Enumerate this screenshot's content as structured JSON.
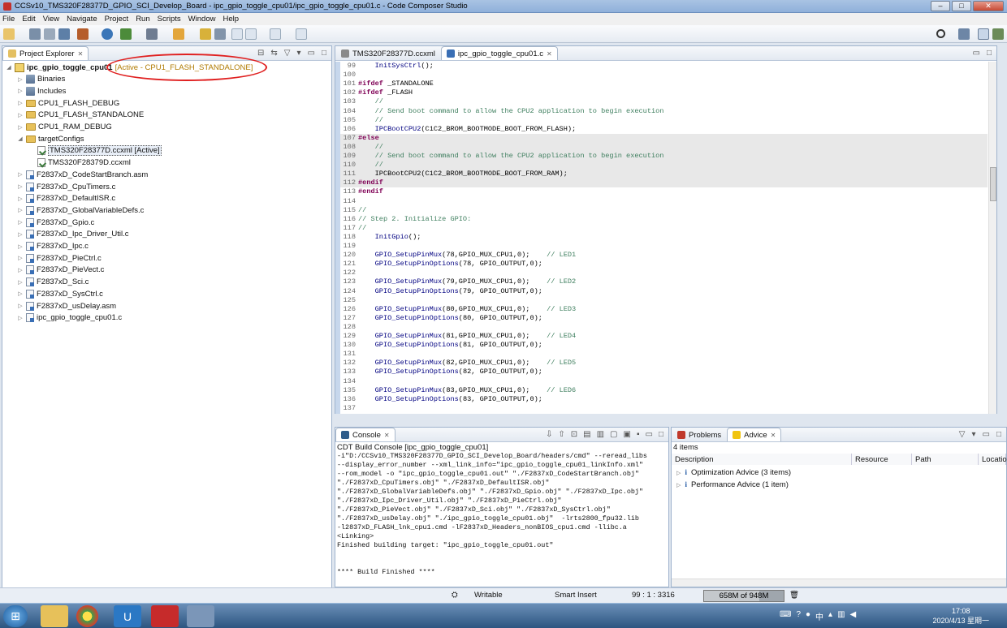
{
  "window": {
    "title": "CCSv10_TMS320F28377D_GPIO_SCI_Develop_Board - ipc_gpio_toggle_cpu01/ipc_gpio_toggle_cpu01.c - Code Composer Studio"
  },
  "menu": [
    "File",
    "Edit",
    "View",
    "Navigate",
    "Project",
    "Run",
    "Scripts",
    "Window",
    "Help"
  ],
  "explorer": {
    "tab_label": "Project Explorer",
    "project_name": "ipc_gpio_toggle_cpu01",
    "project_status": "[Active - CPU1_FLASH_STANDALONE]",
    "items": [
      {
        "label": "Binaries",
        "kind": "lib",
        "indent": 1,
        "arrow": "▷"
      },
      {
        "label": "Includes",
        "kind": "lib",
        "indent": 1,
        "arrow": "▷"
      },
      {
        "label": "CPU1_FLASH_DEBUG",
        "kind": "folder",
        "indent": 1,
        "arrow": "▷"
      },
      {
        "label": "CPU1_FLASH_STANDALONE",
        "kind": "folder",
        "indent": 1,
        "arrow": "▷"
      },
      {
        "label": "CPU1_RAM_DEBUG",
        "kind": "folder",
        "indent": 1,
        "arrow": "▷"
      },
      {
        "label": "targetConfigs",
        "kind": "folder",
        "indent": 1,
        "arrow": "◢"
      },
      {
        "label": "TMS320F28377D.ccxml [Active]",
        "kind": "xml",
        "indent": 2,
        "arrow": "",
        "boxed": true
      },
      {
        "label": "TMS320F28379D.ccxml",
        "kind": "xml",
        "indent": 2,
        "arrow": ""
      },
      {
        "label": "F2837xD_CodeStartBranch.asm",
        "kind": "c",
        "indent": 1,
        "arrow": "▷"
      },
      {
        "label": "F2837xD_CpuTimers.c",
        "kind": "c",
        "indent": 1,
        "arrow": "▷"
      },
      {
        "label": "F2837xD_DefaultISR.c",
        "kind": "c",
        "indent": 1,
        "arrow": "▷"
      },
      {
        "label": "F2837xD_GlobalVariableDefs.c",
        "kind": "c",
        "indent": 1,
        "arrow": "▷"
      },
      {
        "label": "F2837xD_Gpio.c",
        "kind": "c",
        "indent": 1,
        "arrow": "▷"
      },
      {
        "label": "F2837xD_Ipc_Driver_Util.c",
        "kind": "c",
        "indent": 1,
        "arrow": "▷"
      },
      {
        "label": "F2837xD_Ipc.c",
        "kind": "c",
        "indent": 1,
        "arrow": "▷"
      },
      {
        "label": "F2837xD_PieCtrl.c",
        "kind": "c",
        "indent": 1,
        "arrow": "▷"
      },
      {
        "label": "F2837xD_PieVect.c",
        "kind": "c",
        "indent": 1,
        "arrow": "▷"
      },
      {
        "label": "F2837xD_Sci.c",
        "kind": "c",
        "indent": 1,
        "arrow": "▷"
      },
      {
        "label": "F2837xD_SysCtrl.c",
        "kind": "c",
        "indent": 1,
        "arrow": "▷"
      },
      {
        "label": "F2837xD_usDelay.asm",
        "kind": "c",
        "indent": 1,
        "arrow": "▷"
      },
      {
        "label": "ipc_gpio_toggle_cpu01.c",
        "kind": "c",
        "indent": 1,
        "arrow": "▷"
      }
    ]
  },
  "editor": {
    "tabs": [
      {
        "label": "TMS320F28377D.ccxml",
        "active": false
      },
      {
        "label": "ipc_gpio_toggle_cpu01.c",
        "active": true
      }
    ],
    "lines": [
      {
        "n": "99",
        "hl": false,
        "parts": [
          [
            "pl",
            "    "
          ],
          [
            "fn",
            "InitSysCtrl"
          ],
          [
            "pl",
            "();"
          ]
        ]
      },
      {
        "n": "100",
        "hl": false,
        "parts": []
      },
      {
        "n": "101",
        "hl": false,
        "parts": [
          [
            "kw",
            "#ifdef"
          ],
          [
            "pl",
            " _STANDALONE"
          ]
        ]
      },
      {
        "n": "102",
        "hl": false,
        "parts": [
          [
            "kw",
            "#ifdef"
          ],
          [
            "pl",
            " _FLASH"
          ]
        ]
      },
      {
        "n": "103",
        "hl": false,
        "parts": [
          [
            "cm",
            "    //"
          ]
        ]
      },
      {
        "n": "104",
        "hl": false,
        "parts": [
          [
            "cm",
            "    // Send boot command to allow the CPU2 application to begin execution"
          ]
        ]
      },
      {
        "n": "105",
        "hl": false,
        "parts": [
          [
            "cm",
            "    //"
          ]
        ]
      },
      {
        "n": "106",
        "hl": false,
        "parts": [
          [
            "pl",
            "    "
          ],
          [
            "fn",
            "IPCBootCPU2"
          ],
          [
            "pl",
            "(C1C2_BROM_BOOTMODE_BOOT_FROM_FLASH);"
          ]
        ]
      },
      {
        "n": "107",
        "hl": true,
        "parts": [
          [
            "kw",
            "#else"
          ]
        ]
      },
      {
        "n": "108",
        "hl": true,
        "parts": [
          [
            "cm",
            "    //"
          ]
        ]
      },
      {
        "n": "109",
        "hl": true,
        "parts": [
          [
            "cm",
            "    // Send boot command to allow the CPU2 application to begin execution"
          ]
        ]
      },
      {
        "n": "110",
        "hl": true,
        "parts": [
          [
            "cm",
            "    //"
          ]
        ]
      },
      {
        "n": "111",
        "hl": true,
        "parts": [
          [
            "pl",
            "    IPCBootCPU2(C1C2_BROM_BOOTMODE_BOOT_FROM_RAM);"
          ]
        ]
      },
      {
        "n": "112",
        "hl": true,
        "parts": [
          [
            "kw",
            "#endif"
          ]
        ]
      },
      {
        "n": "113",
        "hl": false,
        "parts": [
          [
            "kw",
            "#endif"
          ]
        ]
      },
      {
        "n": "114",
        "hl": false,
        "parts": []
      },
      {
        "n": "115",
        "hl": false,
        "parts": [
          [
            "cm",
            "//"
          ]
        ]
      },
      {
        "n": "116",
        "hl": false,
        "parts": [
          [
            "cm",
            "// Step 2. Initialize GPIO:"
          ]
        ]
      },
      {
        "n": "117",
        "hl": false,
        "parts": [
          [
            "cm",
            "//"
          ]
        ]
      },
      {
        "n": "118",
        "hl": false,
        "parts": [
          [
            "pl",
            "    "
          ],
          [
            "fn",
            "InitGpio"
          ],
          [
            "pl",
            "();"
          ]
        ]
      },
      {
        "n": "119",
        "hl": false,
        "parts": []
      },
      {
        "n": "120",
        "hl": false,
        "parts": [
          [
            "pl",
            "    "
          ],
          [
            "fn",
            "GPIO_SetupPinMux"
          ],
          [
            "pl",
            "(78,GPIO_MUX_CPU1,0);    "
          ],
          [
            "cm",
            "// LED1"
          ]
        ]
      },
      {
        "n": "121",
        "hl": false,
        "parts": [
          [
            "pl",
            "    "
          ],
          [
            "fn",
            "GPIO_SetupPinOptions"
          ],
          [
            "pl",
            "(78, GPIO_OUTPUT,0);"
          ]
        ]
      },
      {
        "n": "122",
        "hl": false,
        "parts": []
      },
      {
        "n": "123",
        "hl": false,
        "parts": [
          [
            "pl",
            "    "
          ],
          [
            "fn",
            "GPIO_SetupPinMux"
          ],
          [
            "pl",
            "(79,GPIO_MUX_CPU1,0);    "
          ],
          [
            "cm",
            "// LED2"
          ]
        ]
      },
      {
        "n": "124",
        "hl": false,
        "parts": [
          [
            "pl",
            "    "
          ],
          [
            "fn",
            "GPIO_SetupPinOptions"
          ],
          [
            "pl",
            "(79, GPIO_OUTPUT,0);"
          ]
        ]
      },
      {
        "n": "125",
        "hl": false,
        "parts": []
      },
      {
        "n": "126",
        "hl": false,
        "parts": [
          [
            "pl",
            "    "
          ],
          [
            "fn",
            "GPIO_SetupPinMux"
          ],
          [
            "pl",
            "(80,GPIO_MUX_CPU1,0);    "
          ],
          [
            "cm",
            "// LED3"
          ]
        ]
      },
      {
        "n": "127",
        "hl": false,
        "parts": [
          [
            "pl",
            "    "
          ],
          [
            "fn",
            "GPIO_SetupPinOptions"
          ],
          [
            "pl",
            "(80, GPIO_OUTPUT,0);"
          ]
        ]
      },
      {
        "n": "128",
        "hl": false,
        "parts": []
      },
      {
        "n": "129",
        "hl": false,
        "parts": [
          [
            "pl",
            "    "
          ],
          [
            "fn",
            "GPIO_SetupPinMux"
          ],
          [
            "pl",
            "(81,GPIO_MUX_CPU1,0);    "
          ],
          [
            "cm",
            "// LED4"
          ]
        ]
      },
      {
        "n": "130",
        "hl": false,
        "parts": [
          [
            "pl",
            "    "
          ],
          [
            "fn",
            "GPIO_SetupPinOptions"
          ],
          [
            "pl",
            "(81, GPIO_OUTPUT,0);"
          ]
        ]
      },
      {
        "n": "131",
        "hl": false,
        "parts": []
      },
      {
        "n": "132",
        "hl": false,
        "parts": [
          [
            "pl",
            "    "
          ],
          [
            "fn",
            "GPIO_SetupPinMux"
          ],
          [
            "pl",
            "(82,GPIO_MUX_CPU1,0);    "
          ],
          [
            "cm",
            "// LED5"
          ]
        ]
      },
      {
        "n": "133",
        "hl": false,
        "parts": [
          [
            "pl",
            "    "
          ],
          [
            "fn",
            "GPIO_SetupPinOptions"
          ],
          [
            "pl",
            "(82, GPIO_OUTPUT,0);"
          ]
        ]
      },
      {
        "n": "134",
        "hl": false,
        "parts": []
      },
      {
        "n": "135",
        "hl": false,
        "parts": [
          [
            "pl",
            "    "
          ],
          [
            "fn",
            "GPIO_SetupPinMux"
          ],
          [
            "pl",
            "(83,GPIO_MUX_CPU1,0);    "
          ],
          [
            "cm",
            "// LED6"
          ]
        ]
      },
      {
        "n": "136",
        "hl": false,
        "parts": [
          [
            "pl",
            "    "
          ],
          [
            "fn",
            "GPIO_SetupPinOptions"
          ],
          [
            "pl",
            "(83, GPIO_OUTPUT,0);"
          ]
        ]
      },
      {
        "n": "137",
        "hl": false,
        "parts": []
      }
    ]
  },
  "console": {
    "tab_label": "Console",
    "header": "CDT Build Console [ipc_gpio_toggle_cpu01]",
    "lines": [
      "-i\"D:/CCSv10_TMS320F28377D_GPIO_SCI_Develop_Board/headers/cmd\" --reread_libs",
      "--display_error_number --xml_link_info=\"ipc_gpio_toggle_cpu01_linkInfo.xml\"",
      "--rom_model -o \"ipc_gpio_toggle_cpu01.out\" \"./F2837xD_CodeStartBranch.obj\"",
      "\"./F2837xD_CpuTimers.obj\" \"./F2837xD_DefaultISR.obj\"",
      "\"./F2837xD_GlobalVariableDefs.obj\" \"./F2837xD_Gpio.obj\" \"./F2837xD_Ipc.obj\"",
      "\"./F2837xD_Ipc_Driver_Util.obj\" \"./F2837xD_PieCtrl.obj\"",
      "\"./F2837xD_PieVect.obj\" \"./F2837xD_Sci.obj\" \"./F2837xD_SysCtrl.obj\"",
      "\"./F2837xD_usDelay.obj\" \"./ipc_gpio_toggle_cpu01.obj\"  -lrts2800_fpu32.lib",
      "-l2837xD_FLASH_lnk_cpu1.cmd -lF2837xD_Headers_nonBIOS_cpu1.cmd -llibc.a",
      "<Linking>",
      "Finished building target: \"ipc_gpio_toggle_cpu01.out\"",
      " ",
      " ",
      "**** Build Finished ****"
    ]
  },
  "advice": {
    "tabs": [
      {
        "label": "Problems",
        "active": false
      },
      {
        "label": "Advice",
        "active": true
      }
    ],
    "count": "4 items",
    "columns": [
      "Description",
      "Resource",
      "Path",
      "Locatio"
    ],
    "rows": [
      {
        "label": "Optimization Advice (3 items)"
      },
      {
        "label": "Performance Advice (1 item)"
      }
    ]
  },
  "status": {
    "writable": "Writable",
    "insert_mode": "Smart Insert",
    "position": "99 : 1 : 3316",
    "heap": "658M of 948M",
    "heap_fraction": 0.69
  },
  "taskbar": {
    "time": "17:08",
    "date": "2020/4/13 星期一"
  },
  "colors": {
    "annotation_circle": "#e02020",
    "project_status": "#b07a00",
    "keyword": "#7f0055",
    "comment": "#3f7f5f"
  }
}
